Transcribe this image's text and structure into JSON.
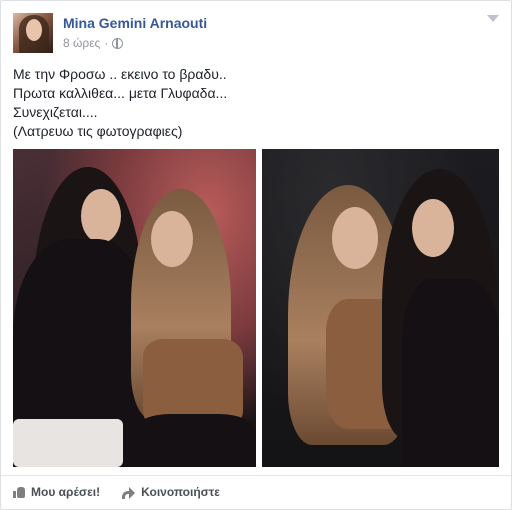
{
  "post": {
    "author": "Mina Gemini Arnaouti",
    "time": "8 ώρες",
    "lines": [
      "Με την Φροσω .. εκεινο το βραδυ..",
      "Πρωτα καλλιθεα... μετα Γλυφαδα...",
      "Συνεχιζεται....",
      "(Λατρευω τις φωτογραφιες)"
    ]
  },
  "actions": {
    "like": "Μου αρέσει!",
    "share": "Κοινοποιήστε"
  },
  "icons": {
    "privacy": "globe-icon",
    "options": "chevron-down-icon",
    "like": "thumbs-up-icon",
    "share": "share-arrow-icon"
  },
  "colors": {
    "author_link": "#365899",
    "meta": "#90949c",
    "text": "#1d2129"
  }
}
